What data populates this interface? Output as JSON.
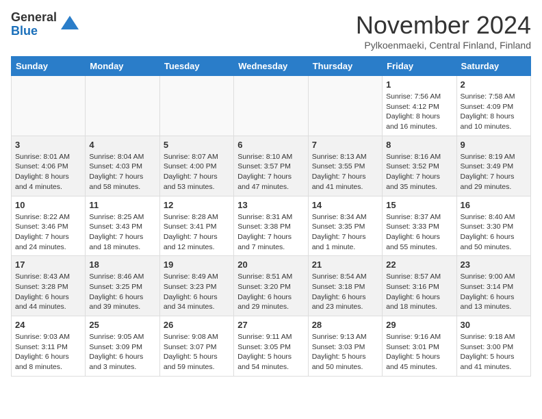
{
  "logo": {
    "general": "General",
    "blue": "Blue"
  },
  "title": "November 2024",
  "subtitle": "Pylkoenmaeki, Central Finland, Finland",
  "days_header": [
    "Sunday",
    "Monday",
    "Tuesday",
    "Wednesday",
    "Thursday",
    "Friday",
    "Saturday"
  ],
  "weeks": [
    [
      {
        "day": "",
        "info": ""
      },
      {
        "day": "",
        "info": ""
      },
      {
        "day": "",
        "info": ""
      },
      {
        "day": "",
        "info": ""
      },
      {
        "day": "",
        "info": ""
      },
      {
        "day": "1",
        "info": "Sunrise: 7:56 AM\nSunset: 4:12 PM\nDaylight: 8 hours and 16 minutes."
      },
      {
        "day": "2",
        "info": "Sunrise: 7:58 AM\nSunset: 4:09 PM\nDaylight: 8 hours and 10 minutes."
      }
    ],
    [
      {
        "day": "3",
        "info": "Sunrise: 8:01 AM\nSunset: 4:06 PM\nDaylight: 8 hours and 4 minutes."
      },
      {
        "day": "4",
        "info": "Sunrise: 8:04 AM\nSunset: 4:03 PM\nDaylight: 7 hours and 58 minutes."
      },
      {
        "day": "5",
        "info": "Sunrise: 8:07 AM\nSunset: 4:00 PM\nDaylight: 7 hours and 53 minutes."
      },
      {
        "day": "6",
        "info": "Sunrise: 8:10 AM\nSunset: 3:57 PM\nDaylight: 7 hours and 47 minutes."
      },
      {
        "day": "7",
        "info": "Sunrise: 8:13 AM\nSunset: 3:55 PM\nDaylight: 7 hours and 41 minutes."
      },
      {
        "day": "8",
        "info": "Sunrise: 8:16 AM\nSunset: 3:52 PM\nDaylight: 7 hours and 35 minutes."
      },
      {
        "day": "9",
        "info": "Sunrise: 8:19 AM\nSunset: 3:49 PM\nDaylight: 7 hours and 29 minutes."
      }
    ],
    [
      {
        "day": "10",
        "info": "Sunrise: 8:22 AM\nSunset: 3:46 PM\nDaylight: 7 hours and 24 minutes."
      },
      {
        "day": "11",
        "info": "Sunrise: 8:25 AM\nSunset: 3:43 PM\nDaylight: 7 hours and 18 minutes."
      },
      {
        "day": "12",
        "info": "Sunrise: 8:28 AM\nSunset: 3:41 PM\nDaylight: 7 hours and 12 minutes."
      },
      {
        "day": "13",
        "info": "Sunrise: 8:31 AM\nSunset: 3:38 PM\nDaylight: 7 hours and 7 minutes."
      },
      {
        "day": "14",
        "info": "Sunrise: 8:34 AM\nSunset: 3:35 PM\nDaylight: 7 hours and 1 minute."
      },
      {
        "day": "15",
        "info": "Sunrise: 8:37 AM\nSunset: 3:33 PM\nDaylight: 6 hours and 55 minutes."
      },
      {
        "day": "16",
        "info": "Sunrise: 8:40 AM\nSunset: 3:30 PM\nDaylight: 6 hours and 50 minutes."
      }
    ],
    [
      {
        "day": "17",
        "info": "Sunrise: 8:43 AM\nSunset: 3:28 PM\nDaylight: 6 hours and 44 minutes."
      },
      {
        "day": "18",
        "info": "Sunrise: 8:46 AM\nSunset: 3:25 PM\nDaylight: 6 hours and 39 minutes."
      },
      {
        "day": "19",
        "info": "Sunrise: 8:49 AM\nSunset: 3:23 PM\nDaylight: 6 hours and 34 minutes."
      },
      {
        "day": "20",
        "info": "Sunrise: 8:51 AM\nSunset: 3:20 PM\nDaylight: 6 hours and 29 minutes."
      },
      {
        "day": "21",
        "info": "Sunrise: 8:54 AM\nSunset: 3:18 PM\nDaylight: 6 hours and 23 minutes."
      },
      {
        "day": "22",
        "info": "Sunrise: 8:57 AM\nSunset: 3:16 PM\nDaylight: 6 hours and 18 minutes."
      },
      {
        "day": "23",
        "info": "Sunrise: 9:00 AM\nSunset: 3:14 PM\nDaylight: 6 hours and 13 minutes."
      }
    ],
    [
      {
        "day": "24",
        "info": "Sunrise: 9:03 AM\nSunset: 3:11 PM\nDaylight: 6 hours and 8 minutes."
      },
      {
        "day": "25",
        "info": "Sunrise: 9:05 AM\nSunset: 3:09 PM\nDaylight: 6 hours and 3 minutes."
      },
      {
        "day": "26",
        "info": "Sunrise: 9:08 AM\nSunset: 3:07 PM\nDaylight: 5 hours and 59 minutes."
      },
      {
        "day": "27",
        "info": "Sunrise: 9:11 AM\nSunset: 3:05 PM\nDaylight: 5 hours and 54 minutes."
      },
      {
        "day": "28",
        "info": "Sunrise: 9:13 AM\nSunset: 3:03 PM\nDaylight: 5 hours and 50 minutes."
      },
      {
        "day": "29",
        "info": "Sunrise: 9:16 AM\nSunset: 3:01 PM\nDaylight: 5 hours and 45 minutes."
      },
      {
        "day": "30",
        "info": "Sunrise: 9:18 AM\nSunset: 3:00 PM\nDaylight: 5 hours and 41 minutes."
      }
    ]
  ]
}
